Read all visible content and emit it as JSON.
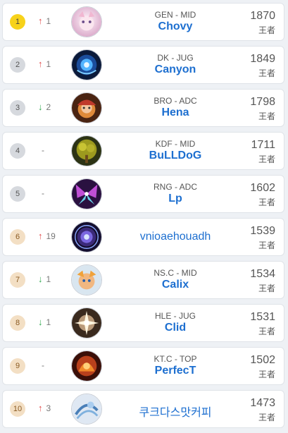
{
  "players": [
    {
      "rank": "1",
      "dir": "up",
      "change": "1",
      "team": "GEN - MID",
      "name": "Chovy",
      "score": "1870",
      "tier": "王者",
      "icon": "white-creature-avatar-icon"
    },
    {
      "rank": "2",
      "dir": "up",
      "change": "1",
      "team": "DK - JUG",
      "name": "Canyon",
      "score": "1849",
      "tier": "王者",
      "icon": "blue-spirit-avatar-icon"
    },
    {
      "rank": "3",
      "dir": "down",
      "change": "2",
      "team": "BRO - ADC",
      "name": "Hena",
      "score": "1798",
      "tier": "王者",
      "icon": "orange-champion-avatar-icon"
    },
    {
      "rank": "4",
      "dir": "none",
      "change": "-",
      "team": "KDF - MID",
      "name": "BuLLDoG",
      "score": "1711",
      "tier": "王者",
      "icon": "golden-tree-avatar-icon"
    },
    {
      "rank": "5",
      "dir": "none",
      "change": "-",
      "team": "RNG - ADC",
      "name": "Lp",
      "score": "1602",
      "tier": "王者",
      "icon": "purple-butterfly-avatar-icon"
    },
    {
      "rank": "6",
      "dir": "up",
      "change": "19",
      "team": "",
      "name": "vnioaehouadh",
      "score": "1539",
      "tier": "王者",
      "icon": "cosmic-orb-avatar-icon"
    },
    {
      "rank": "7",
      "dir": "down",
      "change": "1",
      "team": "NS.C - MID",
      "name": "Calix",
      "score": "1534",
      "tier": "王者",
      "icon": "yordle-avatar-icon"
    },
    {
      "rank": "8",
      "dir": "down",
      "change": "1",
      "team": "HLE - JUG",
      "name": "Clid",
      "score": "1531",
      "tier": "王者",
      "icon": "light-burst-avatar-icon"
    },
    {
      "rank": "9",
      "dir": "none",
      "change": "-",
      "team": "KT.C - TOP",
      "name": "PerfecT",
      "score": "1502",
      "tier": "王者",
      "icon": "fire-champion-avatar-icon"
    },
    {
      "rank": "10",
      "dir": "up",
      "change": "3",
      "team": "",
      "name": "쿠크다스맛커피",
      "score": "1473",
      "tier": "王者",
      "icon": "ice-wind-avatar-icon"
    }
  ]
}
